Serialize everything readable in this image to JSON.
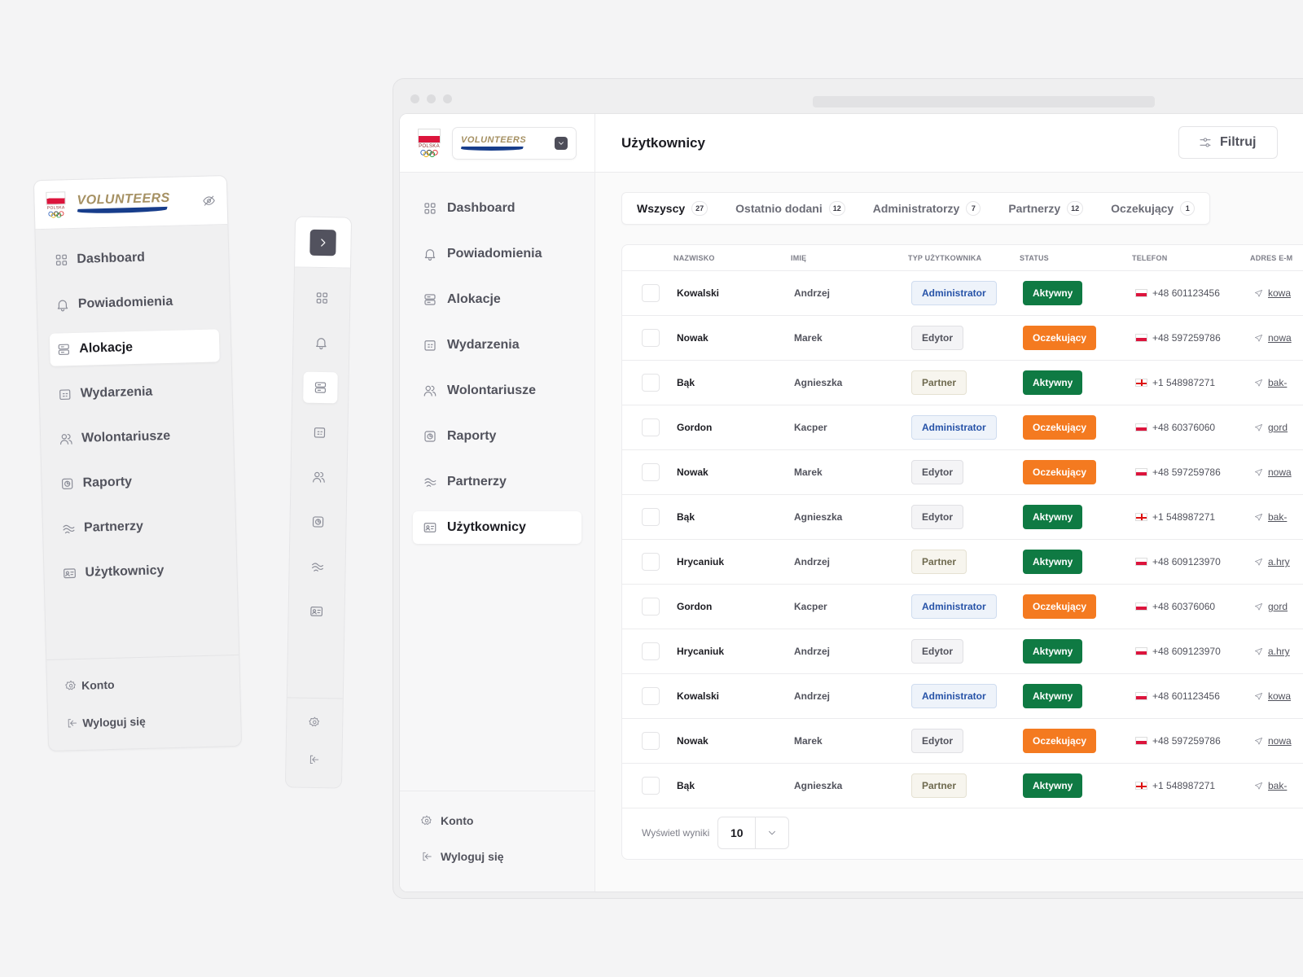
{
  "brand": {
    "country": "POLSKA",
    "wordmark": "VOLUNTEERS"
  },
  "nav": [
    {
      "label": "Dashboard",
      "icon": "dashboard-icon"
    },
    {
      "label": "Powiadomienia",
      "icon": "bell-icon"
    },
    {
      "label": "Alokacje",
      "icon": "server-icon"
    },
    {
      "label": "Wydarzenia",
      "icon": "calendar-icon"
    },
    {
      "label": "Wolontariusze",
      "icon": "users-icon"
    },
    {
      "label": "Raporty",
      "icon": "report-icon"
    },
    {
      "label": "Partnerzy",
      "icon": "handshake-icon"
    },
    {
      "label": "Użytkownicy",
      "icon": "id-card-icon"
    }
  ],
  "footer": {
    "account": "Konto",
    "logout": "Wyloguj się"
  },
  "page": {
    "title": "Użytkownicy",
    "filter": "Filtruj"
  },
  "tabs": [
    {
      "label": "Wszyscy",
      "count": "27"
    },
    {
      "label": "Ostatnio dodani",
      "count": "12"
    },
    {
      "label": "Administratorzy",
      "count": "7"
    },
    {
      "label": "Partnerzy",
      "count": "12"
    },
    {
      "label": "Oczekujący",
      "count": "1"
    }
  ],
  "columns": {
    "surname": "NAZWISKO",
    "name": "IMIĘ",
    "type": "TYP UŻYTKOWNIKA",
    "status": "STATUS",
    "phone": "TELEFON",
    "email": "ADRES E-M"
  },
  "rows": [
    {
      "surname": "Kowalski",
      "name": "Andrzej",
      "type": "Administrator",
      "status": "Aktywny",
      "phone": "+48 601123456",
      "email": "kowa",
      "flag": "pl"
    },
    {
      "surname": "Nowak",
      "name": "Marek",
      "type": "Edytor",
      "status": "Oczekujący",
      "phone": "+48 597259786",
      "email": "nowa",
      "flag": "pl"
    },
    {
      "surname": "Bąk",
      "name": "Agnieszka",
      "type": "Partner",
      "status": "Aktywny",
      "phone": "+1 548987271",
      "email": "bak-",
      "flag": "gb"
    },
    {
      "surname": "Gordon",
      "name": "Kacper",
      "type": "Administrator",
      "status": "Oczekujący",
      "phone": "+48 60376060",
      "email": "gord",
      "flag": "pl"
    },
    {
      "surname": "Nowak",
      "name": "Marek",
      "type": "Edytor",
      "status": "Oczekujący",
      "phone": "+48 597259786",
      "email": "nowa",
      "flag": "pl"
    },
    {
      "surname": "Bąk",
      "name": "Agnieszka",
      "type": "Edytor",
      "status": "Aktywny",
      "phone": "+1 548987271",
      "email": "bak-",
      "flag": "gb"
    },
    {
      "surname": "Hrycaniuk",
      "name": "Andrzej",
      "type": "Partner",
      "status": "Aktywny",
      "phone": "+48 609123970",
      "email": "a.hry",
      "flag": "pl"
    },
    {
      "surname": "Gordon",
      "name": "Kacper",
      "type": "Administrator",
      "status": "Oczekujący",
      "phone": "+48 60376060",
      "email": "gord",
      "flag": "pl"
    },
    {
      "surname": "Hrycaniuk",
      "name": "Andrzej",
      "type": "Edytor",
      "status": "Aktywny",
      "phone": "+48 609123970",
      "email": "a.hry",
      "flag": "pl"
    },
    {
      "surname": "Kowalski",
      "name": "Andrzej",
      "type": "Administrator",
      "status": "Aktywny",
      "phone": "+48 601123456",
      "email": "kowa",
      "flag": "pl"
    },
    {
      "surname": "Nowak",
      "name": "Marek",
      "type": "Edytor",
      "status": "Oczekujący",
      "phone": "+48 597259786",
      "email": "nowa",
      "flag": "pl"
    },
    {
      "surname": "Bąk",
      "name": "Agnieszka",
      "type": "Partner",
      "status": "Aktywny",
      "phone": "+1 548987271",
      "email": "bak-",
      "flag": "gb"
    }
  ],
  "pager": {
    "label": "Wyświetl wyniki",
    "value": "10"
  },
  "colors": {
    "active": "#0f7a43",
    "pending": "#f47a20",
    "admin_text": "#2753a8",
    "brand_gold": "#a59062",
    "brand_blue": "#173d8b"
  }
}
